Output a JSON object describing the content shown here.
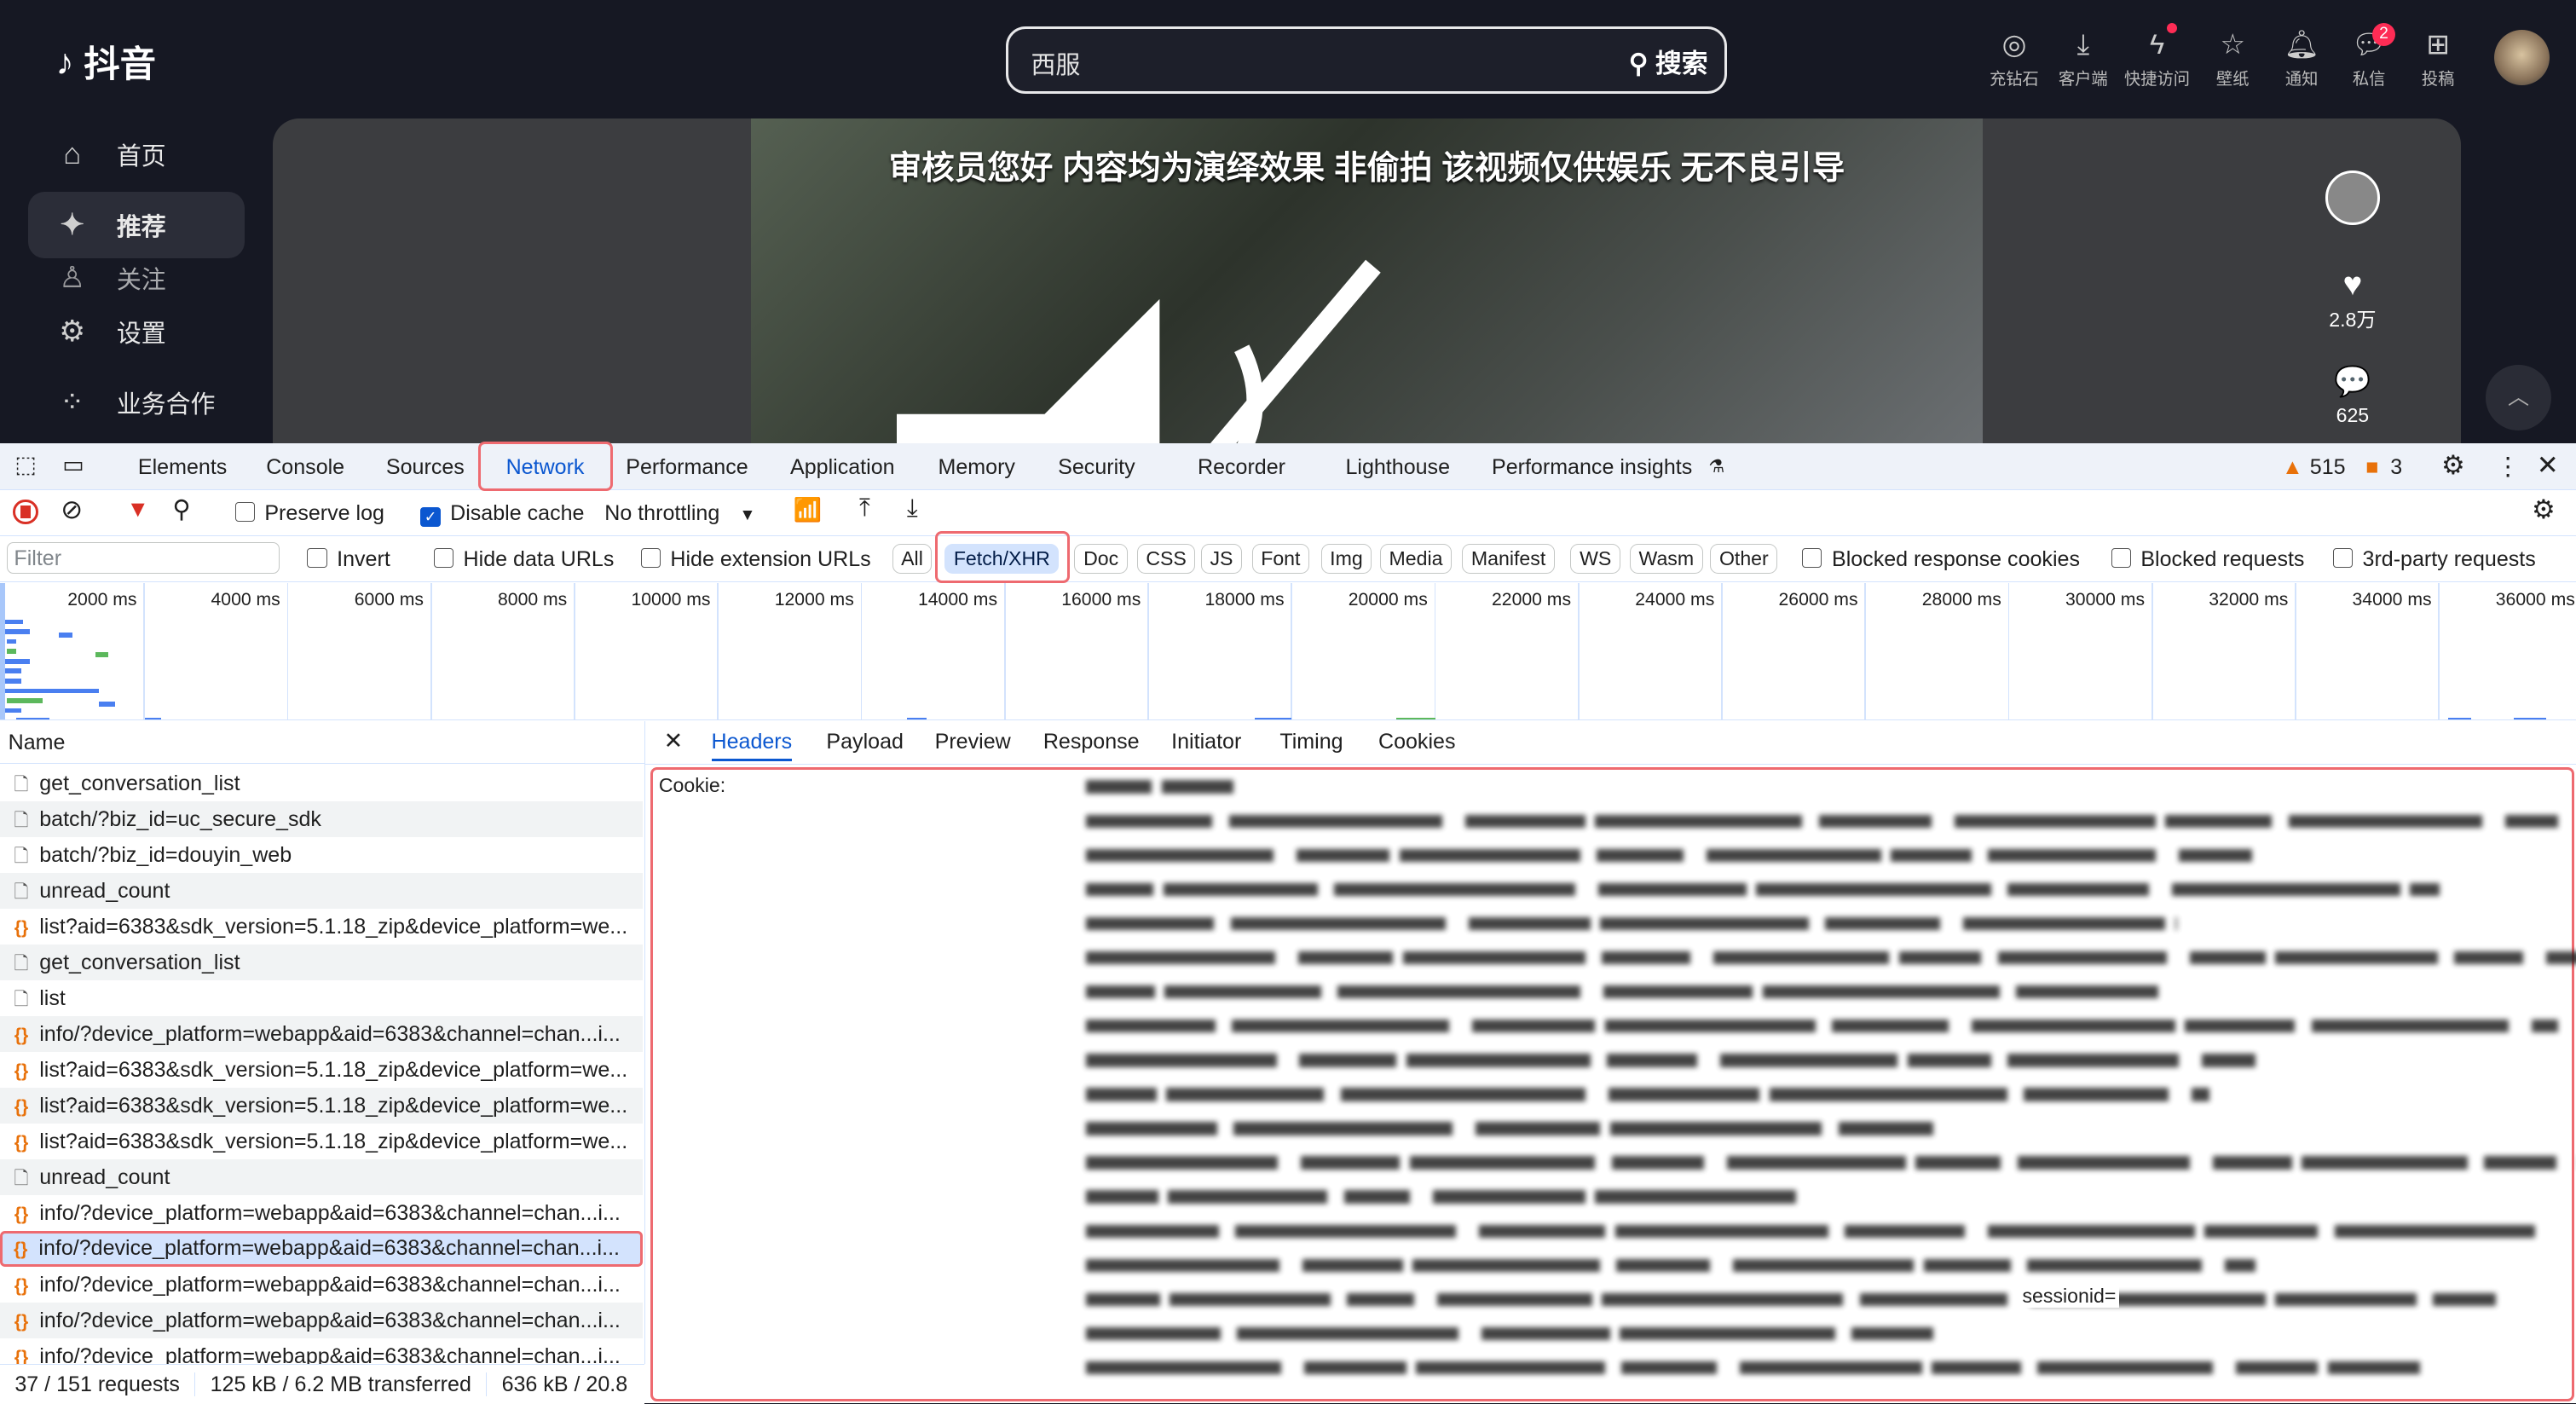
{
  "app": {
    "logo_text": "抖音",
    "search_value": "西服",
    "search_button": "搜索"
  },
  "top_icons": [
    {
      "icon": "diamond-tiktok-icon",
      "label": "充钻石"
    },
    {
      "icon": "download-icon",
      "label": "客户端"
    },
    {
      "icon": "lightning-icon",
      "label": "快捷访问",
      "dot": true
    },
    {
      "icon": "wallpaper-star-icon",
      "label": "壁纸"
    },
    {
      "icon": "bell-icon",
      "label": "通知"
    },
    {
      "icon": "message-icon",
      "label": "私信",
      "badge": "2"
    },
    {
      "icon": "upload-plus-icon",
      "label": "投稿"
    }
  ],
  "sidebar": [
    {
      "icon": "home-icon",
      "label": "首页"
    },
    {
      "icon": "sparkle-icon",
      "label": "推荐",
      "active": true
    },
    {
      "icon": "follow-icon",
      "label": "关注"
    },
    {
      "icon": "settings-icon",
      "label": "设置"
    },
    {
      "icon": "grid-icon",
      "label": "业务合作"
    }
  ],
  "video": {
    "caption": "审核员您好 内容均为演绎效果 非偷拍 该视频仅供娱乐 无不良引导",
    "likes": "2.8万",
    "comments": "625"
  },
  "devtools": {
    "tabs": [
      "Elements",
      "Console",
      "Sources",
      "Network",
      "Performance",
      "Application",
      "Memory",
      "Security",
      "Recorder",
      "Lighthouse",
      "Performance insights"
    ],
    "active_tab": "Network",
    "warnings": "515",
    "issues": "3",
    "toolbar": {
      "preserve_log": "Preserve log",
      "preserve_log_checked": false,
      "disable_cache": "Disable cache",
      "disable_cache_checked": true,
      "throttling": "No throttling"
    },
    "filter": {
      "placeholder": "Filter",
      "invert": "Invert",
      "hide_data_urls": "Hide data URLs",
      "hide_extension_urls": "Hide extension URLs",
      "types": [
        "All",
        "Fetch/XHR",
        "Doc",
        "CSS",
        "JS",
        "Font",
        "Img",
        "Media",
        "Manifest",
        "WS",
        "Wasm",
        "Other"
      ],
      "active_type": "Fetch/XHR",
      "blocked_response_cookies": "Blocked response cookies",
      "blocked_requests": "Blocked requests",
      "third_party": "3rd-party requests"
    },
    "timeline_ticks": [
      "2000 ms",
      "4000 ms",
      "6000 ms",
      "8000 ms",
      "10000 ms",
      "12000 ms",
      "14000 ms",
      "16000 ms",
      "18000 ms",
      "20000 ms",
      "22000 ms",
      "24000 ms",
      "26000 ms",
      "28000 ms",
      "30000 ms",
      "32000 ms",
      "34000 ms",
      "36000 ms"
    ],
    "list_header": "Name",
    "requests": [
      {
        "name": "get_conversation_list",
        "type": "doc"
      },
      {
        "name": "batch/?biz_id=uc_secure_sdk",
        "type": "doc"
      },
      {
        "name": "batch/?biz_id=douyin_web",
        "type": "doc"
      },
      {
        "name": "unread_count",
        "type": "doc"
      },
      {
        "name": "list?aid=6383&sdk_version=5.1.18_zip&device_platform=we...",
        "type": "fetch"
      },
      {
        "name": "get_conversation_list",
        "type": "doc"
      },
      {
        "name": "list",
        "type": "doc"
      },
      {
        "name": "info/?device_platform=webapp&aid=6383&channel=chan...i...",
        "type": "fetch"
      },
      {
        "name": "list?aid=6383&sdk_version=5.1.18_zip&device_platform=we...",
        "type": "fetch"
      },
      {
        "name": "list?aid=6383&sdk_version=5.1.18_zip&device_platform=we...",
        "type": "fetch"
      },
      {
        "name": "list?aid=6383&sdk_version=5.1.18_zip&device_platform=we...",
        "type": "fetch"
      },
      {
        "name": "unread_count",
        "type": "doc"
      },
      {
        "name": "info/?device_platform=webapp&aid=6383&channel=chan...i...",
        "type": "fetch"
      },
      {
        "name": "info/?device_platform=webapp&aid=6383&channel=chan...i...",
        "type": "fetch",
        "selected": true
      },
      {
        "name": "info/?device_platform=webapp&aid=6383&channel=chan...i...",
        "type": "fetch"
      },
      {
        "name": "info/?device_platform=webapp&aid=6383&channel=chan...i...",
        "type": "fetch"
      },
      {
        "name": "info/?device_platform=webapp&aid=6383&channel=chan...i...",
        "type": "fetch"
      }
    ],
    "status": {
      "requests": "37 / 151 requests",
      "transferred": "125 kB / 6.2 MB transferred",
      "resources": "636 kB / 20.8"
    },
    "detail_tabs": [
      "Headers",
      "Payload",
      "Preview",
      "Response",
      "Initiator",
      "Timing",
      "Cookies"
    ],
    "active_detail_tab": "Headers",
    "header_name": "Cookie:",
    "visible_cookie_fragment": "sessionid="
  }
}
